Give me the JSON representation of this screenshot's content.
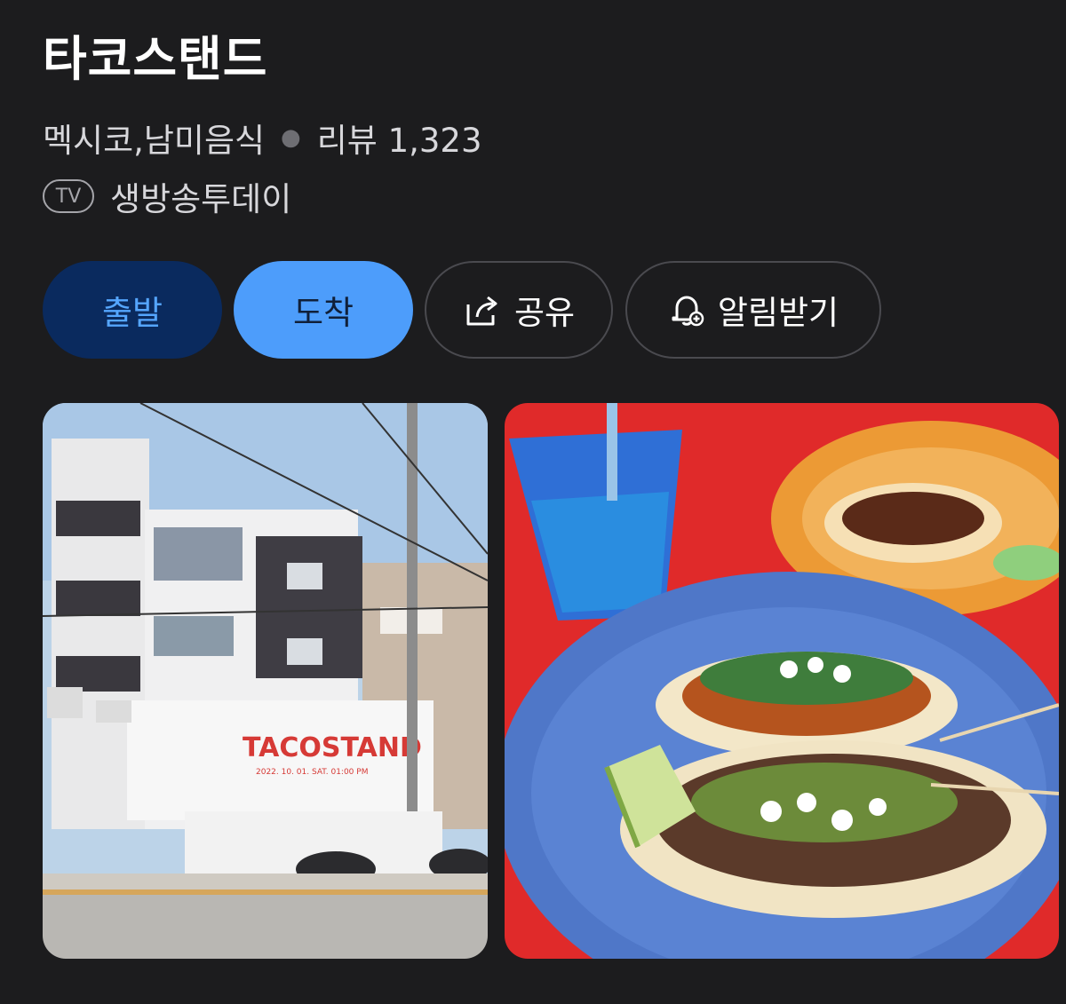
{
  "place": {
    "name": "타코스탠드",
    "category": "멕시코,남미음식",
    "review_label": "리뷰 1,323",
    "tv_badge": "TV",
    "tv_show": "생방송투데이"
  },
  "actions": {
    "depart": "출발",
    "arrive": "도착",
    "share": "공유",
    "notify": "알림받기"
  },
  "photos": {
    "storefront_banner": "TACOSTAND",
    "storefront_subtext": "2022. 10. 01. SAT. 01:00 PM"
  },
  "colors": {
    "background": "#1c1c1e",
    "depart_bg": "#0a2a5e",
    "depart_text": "#55a6ff",
    "arrive_bg": "#4d9dfb"
  },
  "icons": [
    "share-icon",
    "bell-icon"
  ]
}
